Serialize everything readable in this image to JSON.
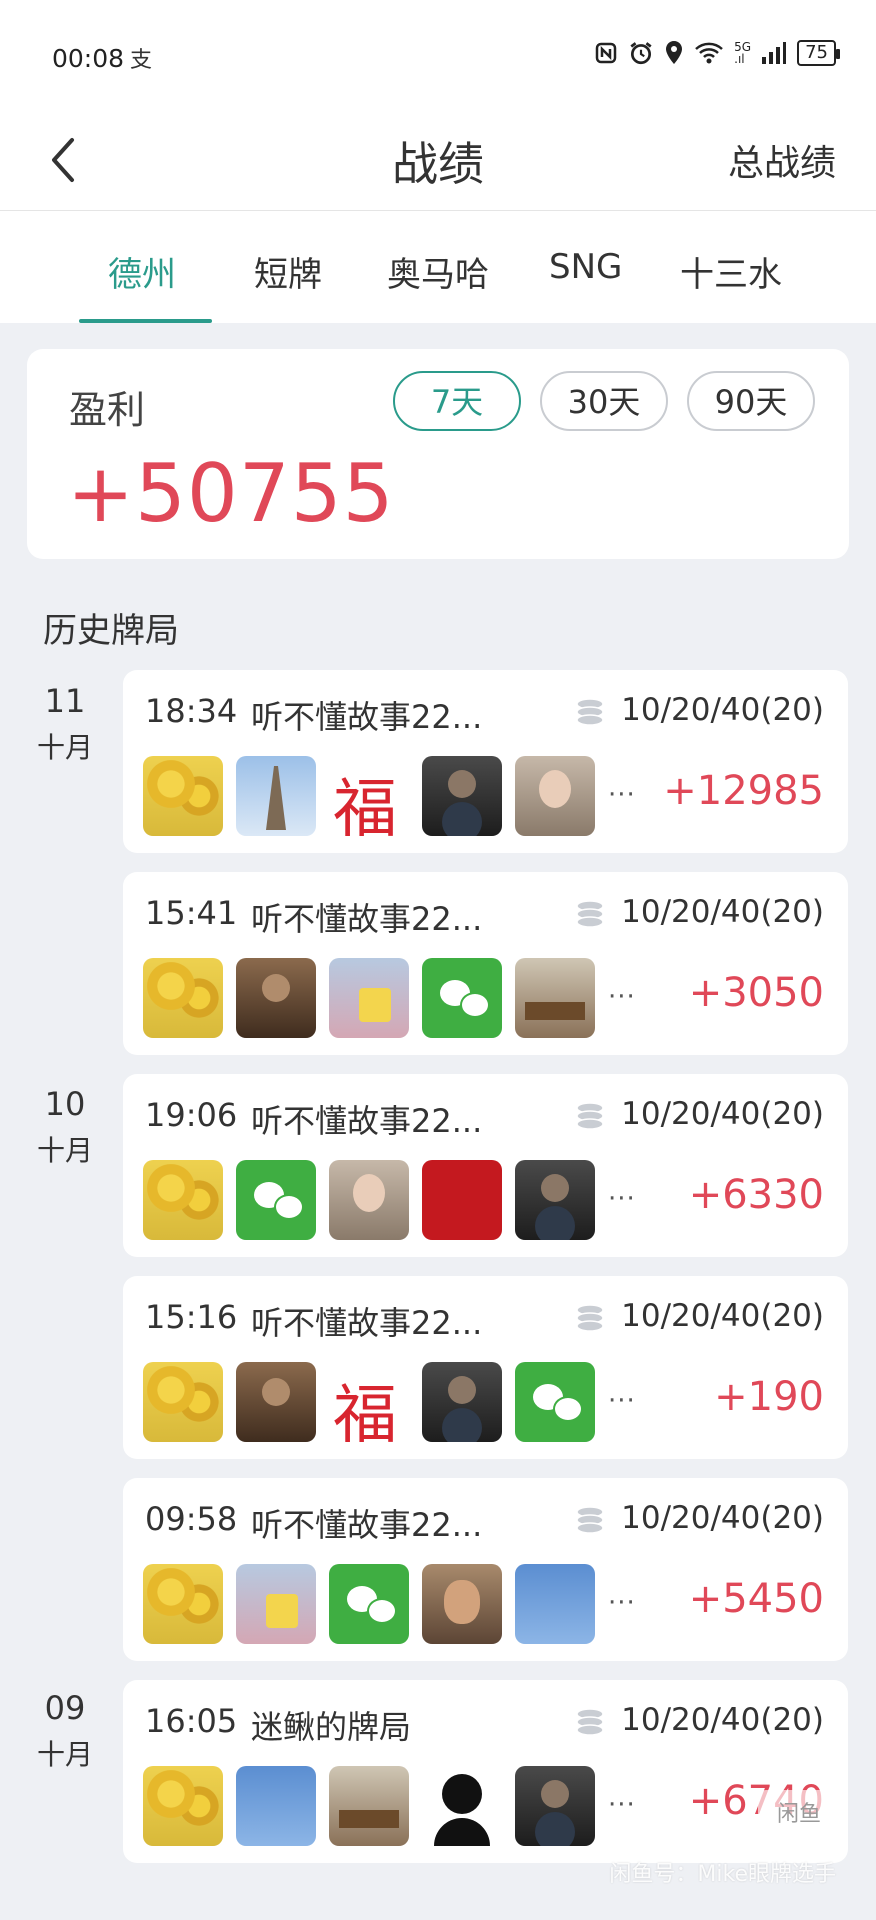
{
  "status_bar": {
    "time": "00:08",
    "notification_glyph": "支",
    "network": "5G",
    "battery": "75",
    "icons": [
      "nfc-icon",
      "alarm-icon",
      "location-icon",
      "wifi-icon",
      "signal-icon",
      "battery-icon"
    ]
  },
  "header": {
    "back_icon": "chevron-left-icon",
    "title": "战绩",
    "right_action": "总战绩"
  },
  "tabs": [
    {
      "label": "德州",
      "active": true
    },
    {
      "label": "短牌",
      "active": false
    },
    {
      "label": "奥马哈",
      "active": false
    },
    {
      "label": "SNG",
      "active": false
    },
    {
      "label": "十三水",
      "active": false
    }
  ],
  "profit": {
    "label": "盈利",
    "value": "+50755",
    "periods": [
      {
        "label": "7天",
        "active": true
      },
      {
        "label": "30天",
        "active": false
      },
      {
        "label": "90天",
        "active": false
      }
    ]
  },
  "history": {
    "title": "历史牌局",
    "dates": [
      {
        "day": "11",
        "month": "十月"
      },
      {
        "day": "10",
        "month": "十月"
      },
      {
        "day": "09",
        "month": "十月"
      }
    ],
    "games": [
      {
        "time": "18:34",
        "name": "听不懂故事22...",
        "blinds": "10/20/40(20)",
        "result": "+12985",
        "more": "···",
        "avatars": [
          "sunflower",
          "pagoda",
          "fu",
          "dark",
          "girl"
        ]
      },
      {
        "time": "15:41",
        "name": "听不懂故事22...",
        "blinds": "10/20/40(20)",
        "result": "+3050",
        "more": "···",
        "avatars": [
          "sunflower",
          "man",
          "sponge",
          "wechat",
          "office"
        ]
      },
      {
        "time": "19:06",
        "name": "听不懂故事22...",
        "blinds": "10/20/40(20)",
        "result": "+6330",
        "more": "···",
        "avatars": [
          "sunflower",
          "wechat",
          "girl",
          "red",
          "dark"
        ]
      },
      {
        "time": "15:16",
        "name": "听不懂故事22...",
        "blinds": "10/20/40(20)",
        "result": "+190",
        "more": "···",
        "avatars": [
          "sunflower",
          "man",
          "fu",
          "dark",
          "wechat"
        ]
      },
      {
        "time": "09:58",
        "name": "听不懂故事22...",
        "blinds": "10/20/40(20)",
        "result": "+5450",
        "more": "···",
        "avatars": [
          "sunflower",
          "sponge",
          "wechat",
          "face",
          "blue"
        ]
      },
      {
        "time": "16:05",
        "name": "迷鳅的牌局",
        "blinds": "10/20/40(20)",
        "result": "+6740",
        "more": "···",
        "avatars": [
          "sunflower",
          "blue",
          "office",
          "anime",
          "dark"
        ]
      }
    ]
  },
  "watermark": {
    "button": "闲鱼",
    "text": "闲鱼号：Mike眼牌选手"
  },
  "colors": {
    "accent": "#2a9b8b",
    "profit": "#e04858",
    "background": "#eef0f4"
  }
}
